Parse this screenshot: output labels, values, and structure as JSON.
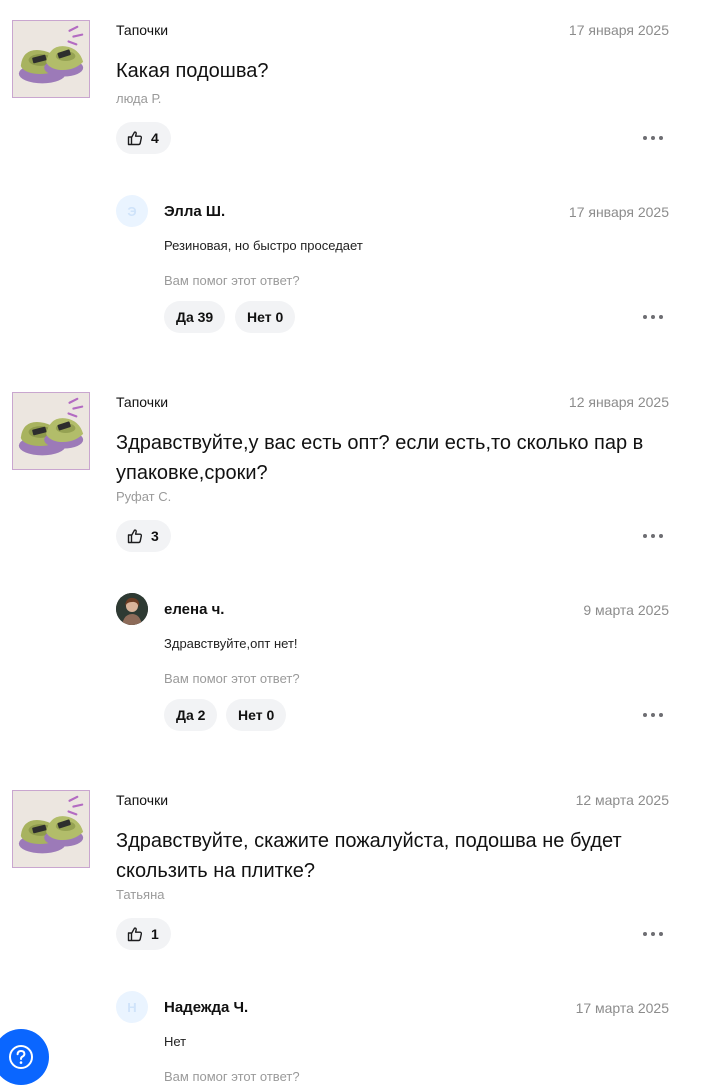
{
  "questions": [
    {
      "product": "Тапочки",
      "date": "17 января 2025",
      "text": "Какая подошва?",
      "author": "люда Р.",
      "likes": "4",
      "answer": {
        "avatar_letter": "Э",
        "name": "Элла Ш.",
        "date": "17 января 2025",
        "text": "Резиновая, но быстро проседает",
        "helpful_prompt": "Вам помог этот ответ?",
        "yes_label": "Да 39",
        "no_label": "Нет 0"
      }
    },
    {
      "product": "Тапочки",
      "date": "12 января 2025",
      "text": "Здравствуйте,у вас есть опт? если есть,то сколько пар в упаковке,сроки?",
      "author": "Руфат С.",
      "likes": "3",
      "answer": {
        "avatar_letter": "",
        "name": "елена ч.",
        "date": "9 марта 2025",
        "text": "Здравствуйте,опт нет!",
        "helpful_prompt": "Вам помог этот ответ?",
        "yes_label": "Да 2",
        "no_label": "Нет 0"
      }
    },
    {
      "product": "Тапочки",
      "date": "12 марта 2025",
      "text": "Здравствуйте, скажите пожалуйста, подошва не будет скользить на плитке?",
      "author": "Татьяна",
      "likes": "1",
      "answer": {
        "avatar_letter": "Н",
        "name": "Надежда Ч.",
        "date": "17 марта 2025",
        "text": "Нет",
        "helpful_prompt": "Вам помог этот ответ?"
      }
    }
  ],
  "icons": {
    "like": "thumbs-up-icon",
    "more": "more-dots-icon",
    "help": "question-icon"
  },
  "colors": {
    "fab": "#0a66ff",
    "button_bg": "#f2f3f5",
    "muted_text": "#9a9a9a"
  }
}
